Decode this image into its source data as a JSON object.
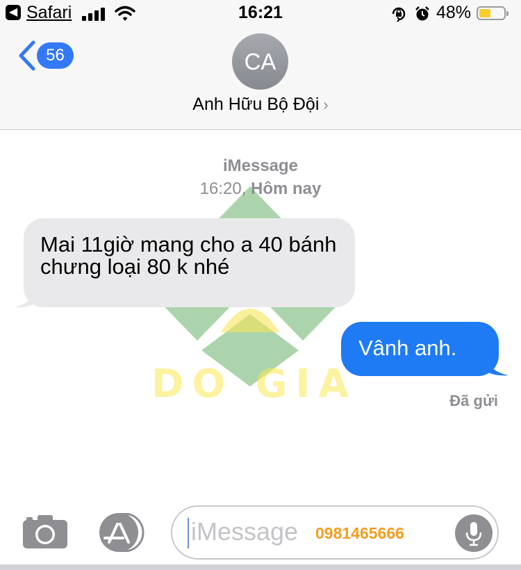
{
  "status_bar": {
    "back_app": "Safari",
    "time": "16:21",
    "battery_percent": "48%",
    "battery_level": 0.48,
    "signal_bars": 4
  },
  "header": {
    "unread_count": "56",
    "avatar_initials": "CA",
    "contact_name": "Anh Hữu Bộ Đội",
    "chevron": "›"
  },
  "thread": {
    "service_label": "iMessage",
    "timestamp_time": "16:20,",
    "timestamp_day": "Hôm nay",
    "messages": [
      {
        "direction": "incoming",
        "text": "Mai 11giờ mang cho a 40 bánh chưng loại 80 k nhé"
      },
      {
        "direction": "outgoing",
        "text": "Vânh anh."
      }
    ],
    "delivered_label": "Đã gửi"
  },
  "watermark": {
    "brand_text": "DO GIA",
    "colors": {
      "green": "#5aa95a",
      "yellow": "#f7e45a"
    }
  },
  "input_bar": {
    "placeholder": "iMessage",
    "phone_number": "0981465666"
  },
  "colors": {
    "accent_blue": "#3478f6",
    "outgoing_bubble": "#1e7bf4",
    "incoming_bubble": "#e9e9eb",
    "secondary_text": "#8e8e93"
  },
  "icons": [
    "back-arrow-icon",
    "cellular-signal-icon",
    "wifi-icon",
    "orientation-lock-icon",
    "alarm-icon",
    "battery-icon",
    "chevron-left-icon",
    "chevron-right-icon",
    "camera-icon",
    "app-store-icon",
    "microphone-icon"
  ]
}
